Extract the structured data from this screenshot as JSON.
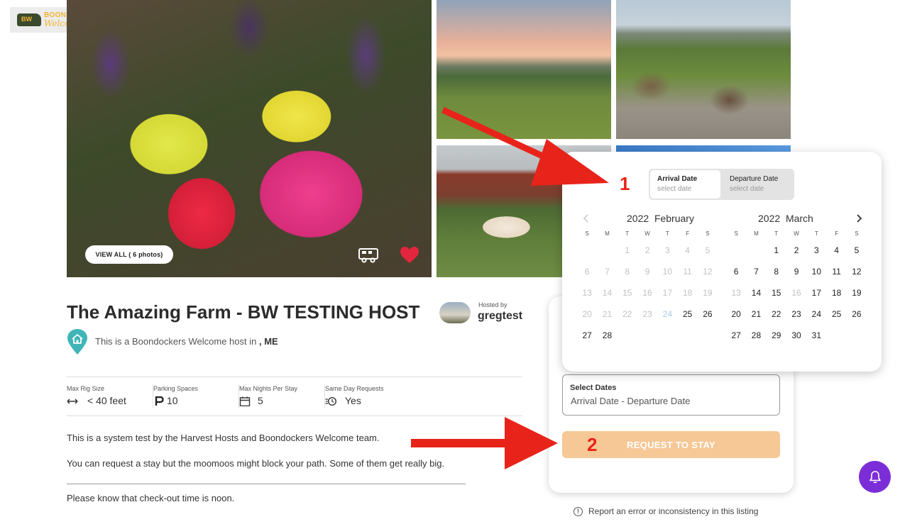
{
  "logo": {
    "badge": "BW",
    "line1": "BOONDOCKERS",
    "line2": "Welcome"
  },
  "gallery": {
    "view_all_label": "VIEW ALL ( 6 photos)"
  },
  "host": {
    "title": "The Amazing Farm - BW TESTING HOST",
    "hosted_by_label": "Hosted by",
    "host_name": "gregtest",
    "location_prefix": "This is a Boondockers Welcome host in ",
    "location_state": ", ME"
  },
  "stats": [
    {
      "label": "Max Rig Size",
      "value": "< 40 feet",
      "icon": "arrows-horizontal-icon"
    },
    {
      "label": "Parking Spaces",
      "value": "10",
      "icon": "parking-icon"
    },
    {
      "label": "Max Nights Per Stay",
      "value": "5",
      "icon": "calendar-icon"
    },
    {
      "label": "Same Day Requests",
      "value": "Yes",
      "icon": "fast-clock-icon"
    }
  ],
  "description": {
    "p1": "This is a system test by the Harvest Hosts and Boondockers Welcome team.",
    "p2": "You can request a stay but the moomoos might block your path. Some of them get really big.",
    "p3": "Please know that check-out time is noon."
  },
  "booking": {
    "select_dates_label": "Select Dates",
    "select_dates_value": "Arrival Date - Departure Date",
    "request_button": "REQUEST TO STAY",
    "report_text": "Report an error or inconsistency in this listing"
  },
  "calendar": {
    "arrival_label": "Arrival Date",
    "arrival_placeholder": "select date",
    "departure_label": "Departure Date",
    "departure_placeholder": "select date",
    "weekday_labels": [
      "S",
      "M",
      "T",
      "W",
      "T",
      "F",
      "S"
    ],
    "months": [
      {
        "year": "2022",
        "name": "February",
        "weeks": [
          [
            {
              "d": ""
            },
            {
              "d": ""
            },
            {
              "d": "1",
              "dis": true
            },
            {
              "d": "2",
              "dis": true
            },
            {
              "d": "3",
              "dis": true
            },
            {
              "d": "4",
              "dis": true
            },
            {
              "d": "5",
              "dis": true
            }
          ],
          [
            {
              "d": "6",
              "dis": true
            },
            {
              "d": "7",
              "dis": true
            },
            {
              "d": "8",
              "dis": true
            },
            {
              "d": "9",
              "dis": true
            },
            {
              "d": "10",
              "dis": true
            },
            {
              "d": "11",
              "dis": true
            },
            {
              "d": "12",
              "dis": true
            }
          ],
          [
            {
              "d": "13",
              "dis": true
            },
            {
              "d": "14",
              "dis": true
            },
            {
              "d": "15",
              "dis": true
            },
            {
              "d": "16",
              "dis": true
            },
            {
              "d": "17",
              "dis": true
            },
            {
              "d": "18",
              "dis": true
            },
            {
              "d": "19",
              "dis": true
            }
          ],
          [
            {
              "d": "20",
              "dis": true
            },
            {
              "d": "21",
              "dis": true
            },
            {
              "d": "22",
              "dis": true
            },
            {
              "d": "23",
              "dis": true
            },
            {
              "d": "24",
              "today": true
            },
            {
              "d": "25"
            },
            {
              "d": "26"
            }
          ],
          [
            {
              "d": "27"
            },
            {
              "d": "28"
            },
            {
              "d": ""
            },
            {
              "d": ""
            },
            {
              "d": ""
            },
            {
              "d": ""
            },
            {
              "d": ""
            }
          ]
        ]
      },
      {
        "year": "2022",
        "name": "March",
        "weeks": [
          [
            {
              "d": ""
            },
            {
              "d": ""
            },
            {
              "d": "1"
            },
            {
              "d": "2"
            },
            {
              "d": "3"
            },
            {
              "d": "4"
            },
            {
              "d": "5"
            }
          ],
          [
            {
              "d": "6"
            },
            {
              "d": "7"
            },
            {
              "d": "8"
            },
            {
              "d": "9"
            },
            {
              "d": "10"
            },
            {
              "d": "11"
            },
            {
              "d": "12"
            }
          ],
          [
            {
              "d": "13",
              "dis": true
            },
            {
              "d": "14"
            },
            {
              "d": "15"
            },
            {
              "d": "16",
              "dis": true
            },
            {
              "d": "17"
            },
            {
              "d": "18"
            },
            {
              "d": "19"
            }
          ],
          [
            {
              "d": "20"
            },
            {
              "d": "21"
            },
            {
              "d": "22"
            },
            {
              "d": "23"
            },
            {
              "d": "24"
            },
            {
              "d": "25"
            },
            {
              "d": "26"
            }
          ],
          [
            {
              "d": "27"
            },
            {
              "d": "28"
            },
            {
              "d": "29"
            },
            {
              "d": "30"
            },
            {
              "d": "31"
            },
            {
              "d": ""
            },
            {
              "d": ""
            }
          ]
        ]
      }
    ]
  },
  "annotations": {
    "step1": "1",
    "step2": "2"
  },
  "colors": {
    "accent_purple": "#7b2ed8",
    "request_button": "#f5c896",
    "annotation_red": "#e8231a",
    "brand_yellow": "#f2b632",
    "heart_red": "#e3263e"
  }
}
